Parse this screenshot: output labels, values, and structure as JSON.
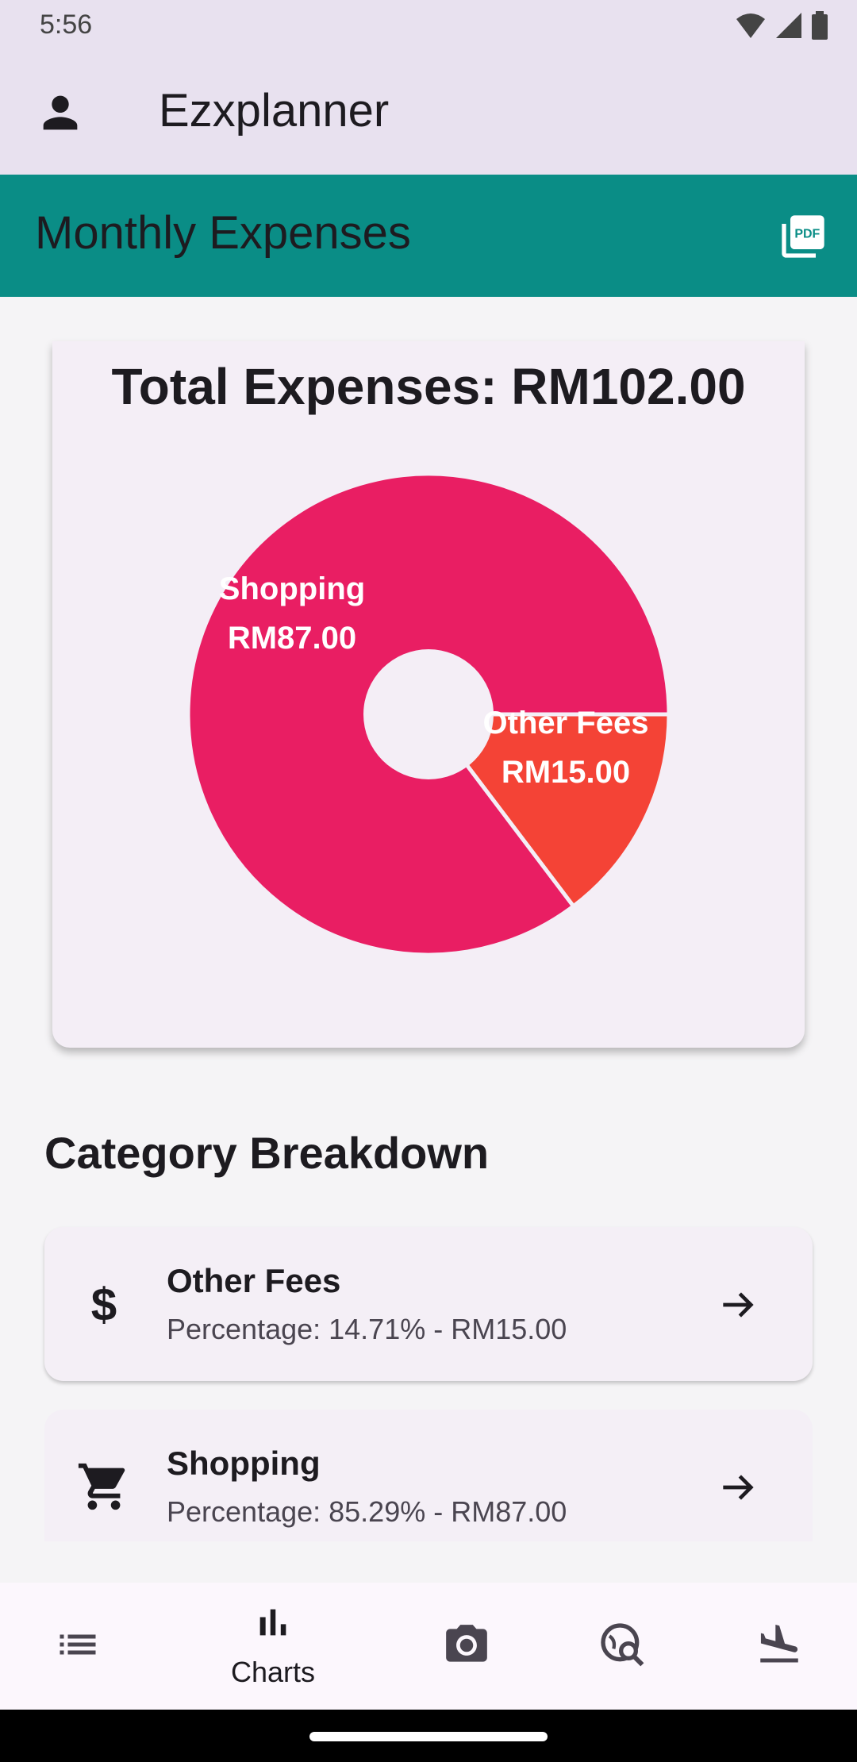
{
  "status": {
    "time": "5:56"
  },
  "app": {
    "title": "Ezxplanner"
  },
  "section": {
    "title": "Monthly Expenses"
  },
  "summary": {
    "total_label": "Total Expenses: RM102.00"
  },
  "chart_data": {
    "type": "pie",
    "categories": [
      "Shopping",
      "Other Fees"
    ],
    "values": [
      87.0,
      15.0
    ],
    "slice_labels": [
      {
        "name": "Shopping",
        "value": "RM87.00"
      },
      {
        "name": "Other Fees",
        "value": "RM15.00"
      }
    ],
    "colors": [
      "#e91e63",
      "#f44336"
    ],
    "donut": true
  },
  "breakdown": {
    "title": "Category Breakdown",
    "items": [
      {
        "name": "Other Fees",
        "detail": "Percentage: 14.71% - RM15.00",
        "icon": "dollar-icon"
      },
      {
        "name": "Shopping",
        "detail": "Percentage: 85.29% - RM87.00",
        "icon": "cart-icon"
      }
    ]
  },
  "nav": {
    "items": [
      {
        "icon": "list-icon",
        "label": ""
      },
      {
        "icon": "bar-chart-icon",
        "label": "Charts",
        "active": true
      },
      {
        "icon": "camera-icon",
        "label": ""
      },
      {
        "icon": "travel-explore-icon",
        "label": ""
      },
      {
        "icon": "flight-land-icon",
        "label": ""
      }
    ]
  }
}
